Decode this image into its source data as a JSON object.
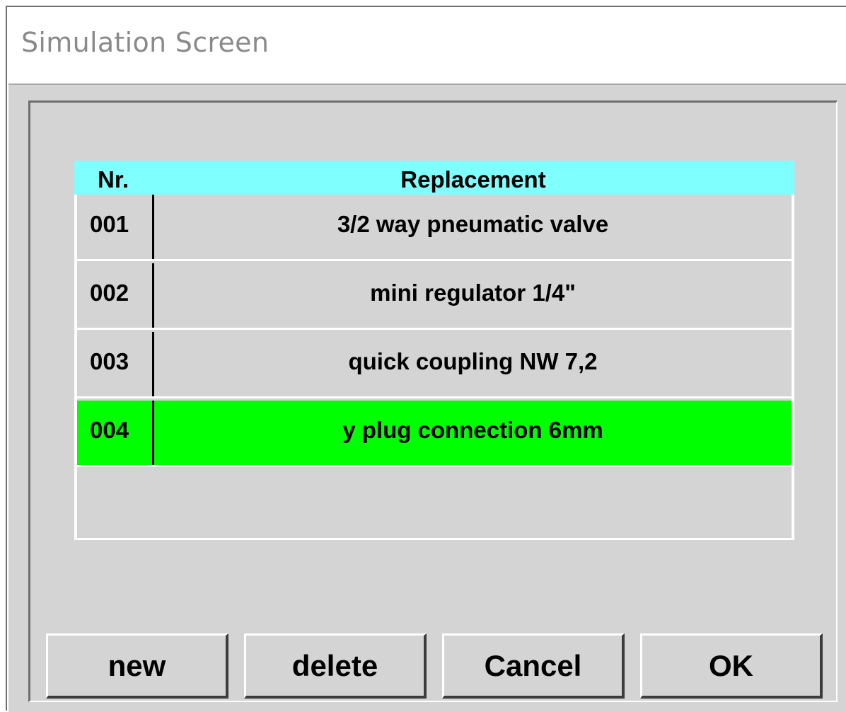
{
  "window": {
    "title": "Simulation Screen"
  },
  "table": {
    "columns": [
      "Nr.",
      "Replacement"
    ],
    "rows": [
      {
        "nr": "001",
        "replacement": "3/2 way pneumatic valve",
        "selected": false
      },
      {
        "nr": "002",
        "replacement": "mini regulator 1/4\"",
        "selected": false
      },
      {
        "nr": "003",
        "replacement": "quick coupling NW 7,2",
        "selected": false
      },
      {
        "nr": "004",
        "replacement": "y plug connection 6mm",
        "selected": true
      }
    ],
    "header_color": "#80ffff",
    "selected_color": "#00ff00"
  },
  "buttons": {
    "new": "new",
    "delete": "delete",
    "cancel": "Cancel",
    "ok": "OK"
  }
}
